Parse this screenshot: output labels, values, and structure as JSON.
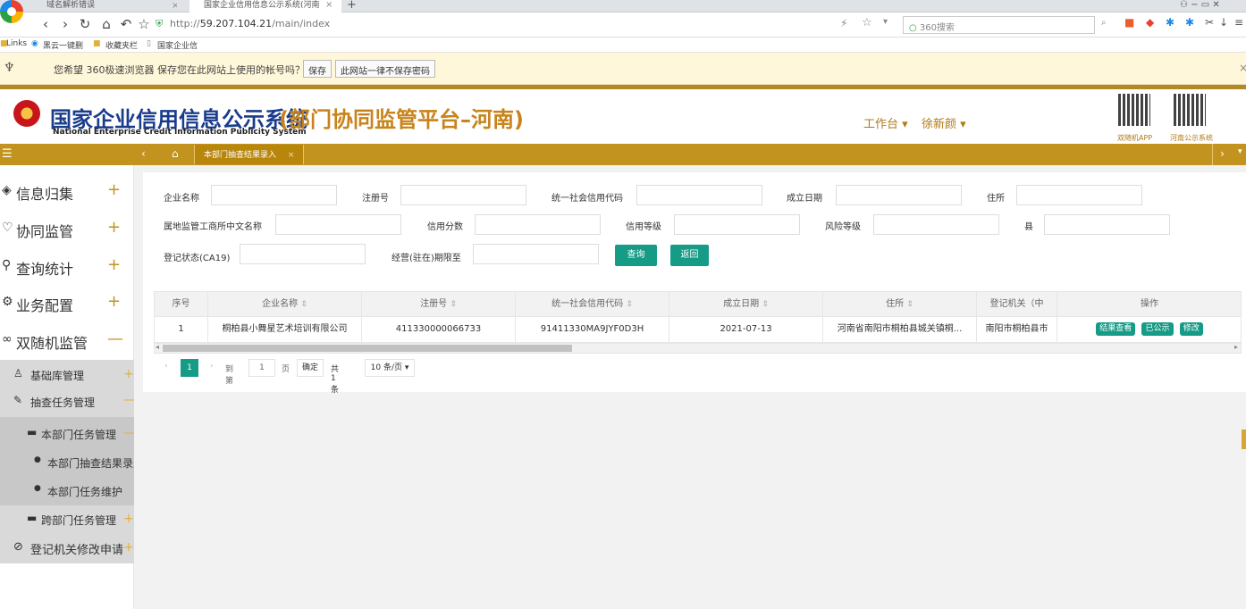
{
  "browser": {
    "tabs": [
      {
        "title": "域名解析错误",
        "active": false
      },
      {
        "title": "国家企业信用信息公示系统(河南",
        "active": true
      }
    ],
    "url_prefix": "http://",
    "url_host": "59.207.104.21",
    "url_path": "/main/index",
    "search_placeholder": "360搜索",
    "bookmarks": [
      "Links",
      "黑云一键删",
      "收藏夹栏",
      "国家企业信"
    ],
    "password_prompt": "您希望 360极速浏览器 保存您在此网站上使用的帐号吗？",
    "save_label": "保存",
    "never_label": "此网站一律不保存密码"
  },
  "app": {
    "title_main": "国家企业信用信息公示系统",
    "title_sub": "(部门协同监管平台–河南)",
    "title_en": "National Enterprise Credit Information Publicity System",
    "workbench": "工作台 ▾",
    "user": "徐新颜 ▾",
    "qr_labels": [
      "双随机APP",
      "河南公示系统"
    ]
  },
  "navtab": {
    "label": "本部门抽查结果录入",
    "close": "×"
  },
  "sidebar": {
    "items": [
      {
        "label": "信息归集",
        "icon": "layers-icon",
        "toggle": "+"
      },
      {
        "label": "协同监管",
        "icon": "shield-icon",
        "toggle": "+"
      },
      {
        "label": "查询统计",
        "icon": "search-icon",
        "toggle": "+"
      },
      {
        "label": "业务配置",
        "icon": "gear-icon",
        "toggle": "+"
      },
      {
        "label": "双随机监管",
        "icon": "link-icon",
        "toggle": "—"
      }
    ],
    "sub": {
      "base": "基础库管理",
      "task": "抽查任务管理",
      "dept_task": "本部门任务管理",
      "dept_result": "本部门抽查结果录入",
      "dept_maintain": "本部门任务维护",
      "cross_task": "跨部门任务管理",
      "reg_change": "登记机关修改申请"
    }
  },
  "form": {
    "labels": {
      "company": "企业名称",
      "regno": "注册号",
      "uscc": "统一社会信用代码",
      "found": "成立日期",
      "addr": "住所",
      "local_office": "属地监管工商所中文名称",
      "credit_score": "信用分数",
      "credit_level": "信用等级",
      "risk_level": "风险等级",
      "county": "县",
      "reg_status": "登记状态(CA19)",
      "expiry": "经营(驻在)期限至"
    },
    "query_label": "查询",
    "back_label": "返回"
  },
  "table": {
    "headers": [
      "序号",
      "企业名称",
      "注册号",
      "统一社会信用代码",
      "成立日期",
      "住所",
      "登记机关（中",
      "操作"
    ],
    "rows": [
      {
        "idx": "1",
        "company": "桐柏县小舞星艺术培训有限公司",
        "regno": "411330000066733",
        "uscc": "91411330MA9JYF0D3H",
        "found": "2021-07-13",
        "addr": "河南省南阳市桐柏县城关镇桐...",
        "reg_office": "南阳市桐柏县市",
        "actions": [
          "结果查看",
          "已公示",
          "修改"
        ]
      }
    ]
  },
  "pager": {
    "current": "1",
    "goto_label": "到第",
    "page_input": "1",
    "page_unit": "页",
    "confirm": "确定",
    "total": "共 1 条",
    "page_size": "10 条/页 ▾"
  }
}
